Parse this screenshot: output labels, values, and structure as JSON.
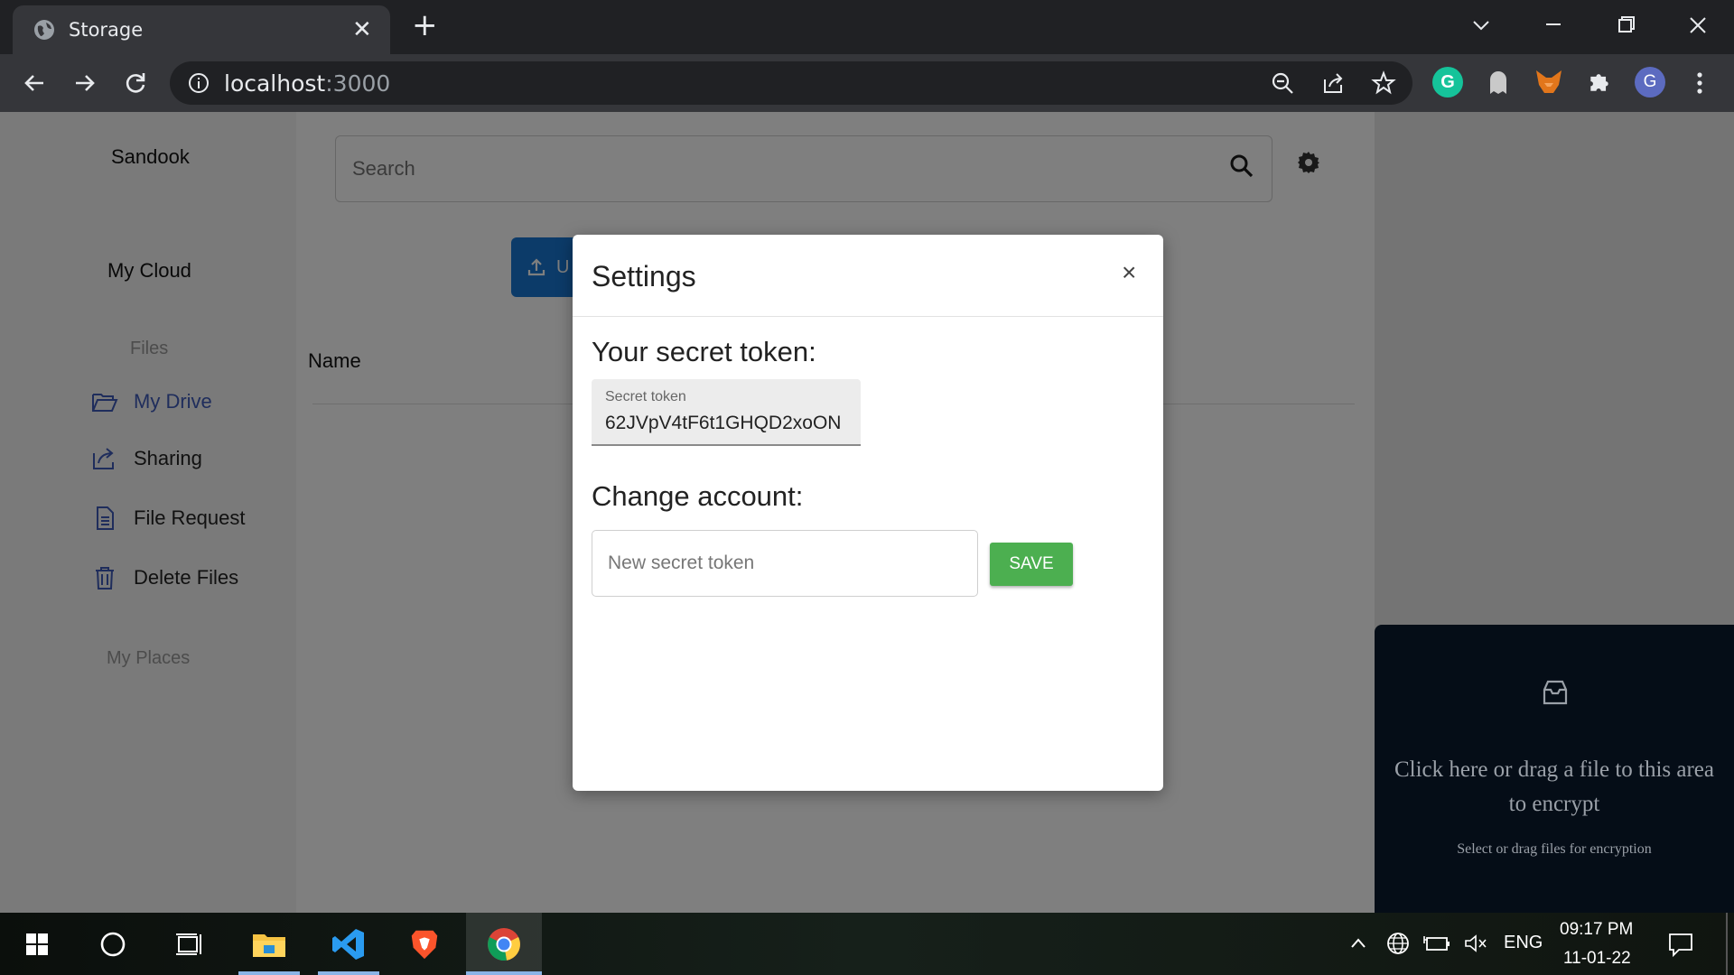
{
  "browser": {
    "tab_title": "Storage",
    "url_host": "localhost",
    "url_port": ":3000",
    "profile_initial": "G",
    "extensions": [
      "grammarly-icon",
      "ghost-icon",
      "metamask-icon",
      "puzzle-icon"
    ]
  },
  "sidebar": {
    "brand": "Sandook",
    "section_cloud": "My Cloud",
    "files_heading": "Files",
    "items": [
      {
        "label": "My Drive",
        "icon": "folder-open-icon"
      },
      {
        "label": "Sharing",
        "icon": "share-icon"
      },
      {
        "label": "File Request",
        "icon": "document-icon"
      },
      {
        "label": "Delete Files",
        "icon": "trash-icon"
      }
    ],
    "places_heading": "My Places"
  },
  "main": {
    "search_placeholder": "Search",
    "upload_label": "U",
    "name_column": "Name"
  },
  "modal": {
    "title": "Settings",
    "close_label": "×",
    "secret_heading": "Your secret token:",
    "token_label": "Secret token",
    "token_value": "62JVpV4tF6t1GHQD2xoON",
    "change_heading": "Change account:",
    "new_token_placeholder": "New secret token",
    "save_label": "SAVE"
  },
  "dropzone": {
    "title": "Click here or drag a file to this area to encrypt",
    "subtitle": "Select or drag files for encryption"
  },
  "taskbar": {
    "language": "ENG",
    "time": "09:17 PM",
    "date": "11-01-22"
  },
  "colors": {
    "accent_blue": "#1976d2",
    "save_green": "#4caf50",
    "sidebar_active": "#3e5bb8"
  }
}
